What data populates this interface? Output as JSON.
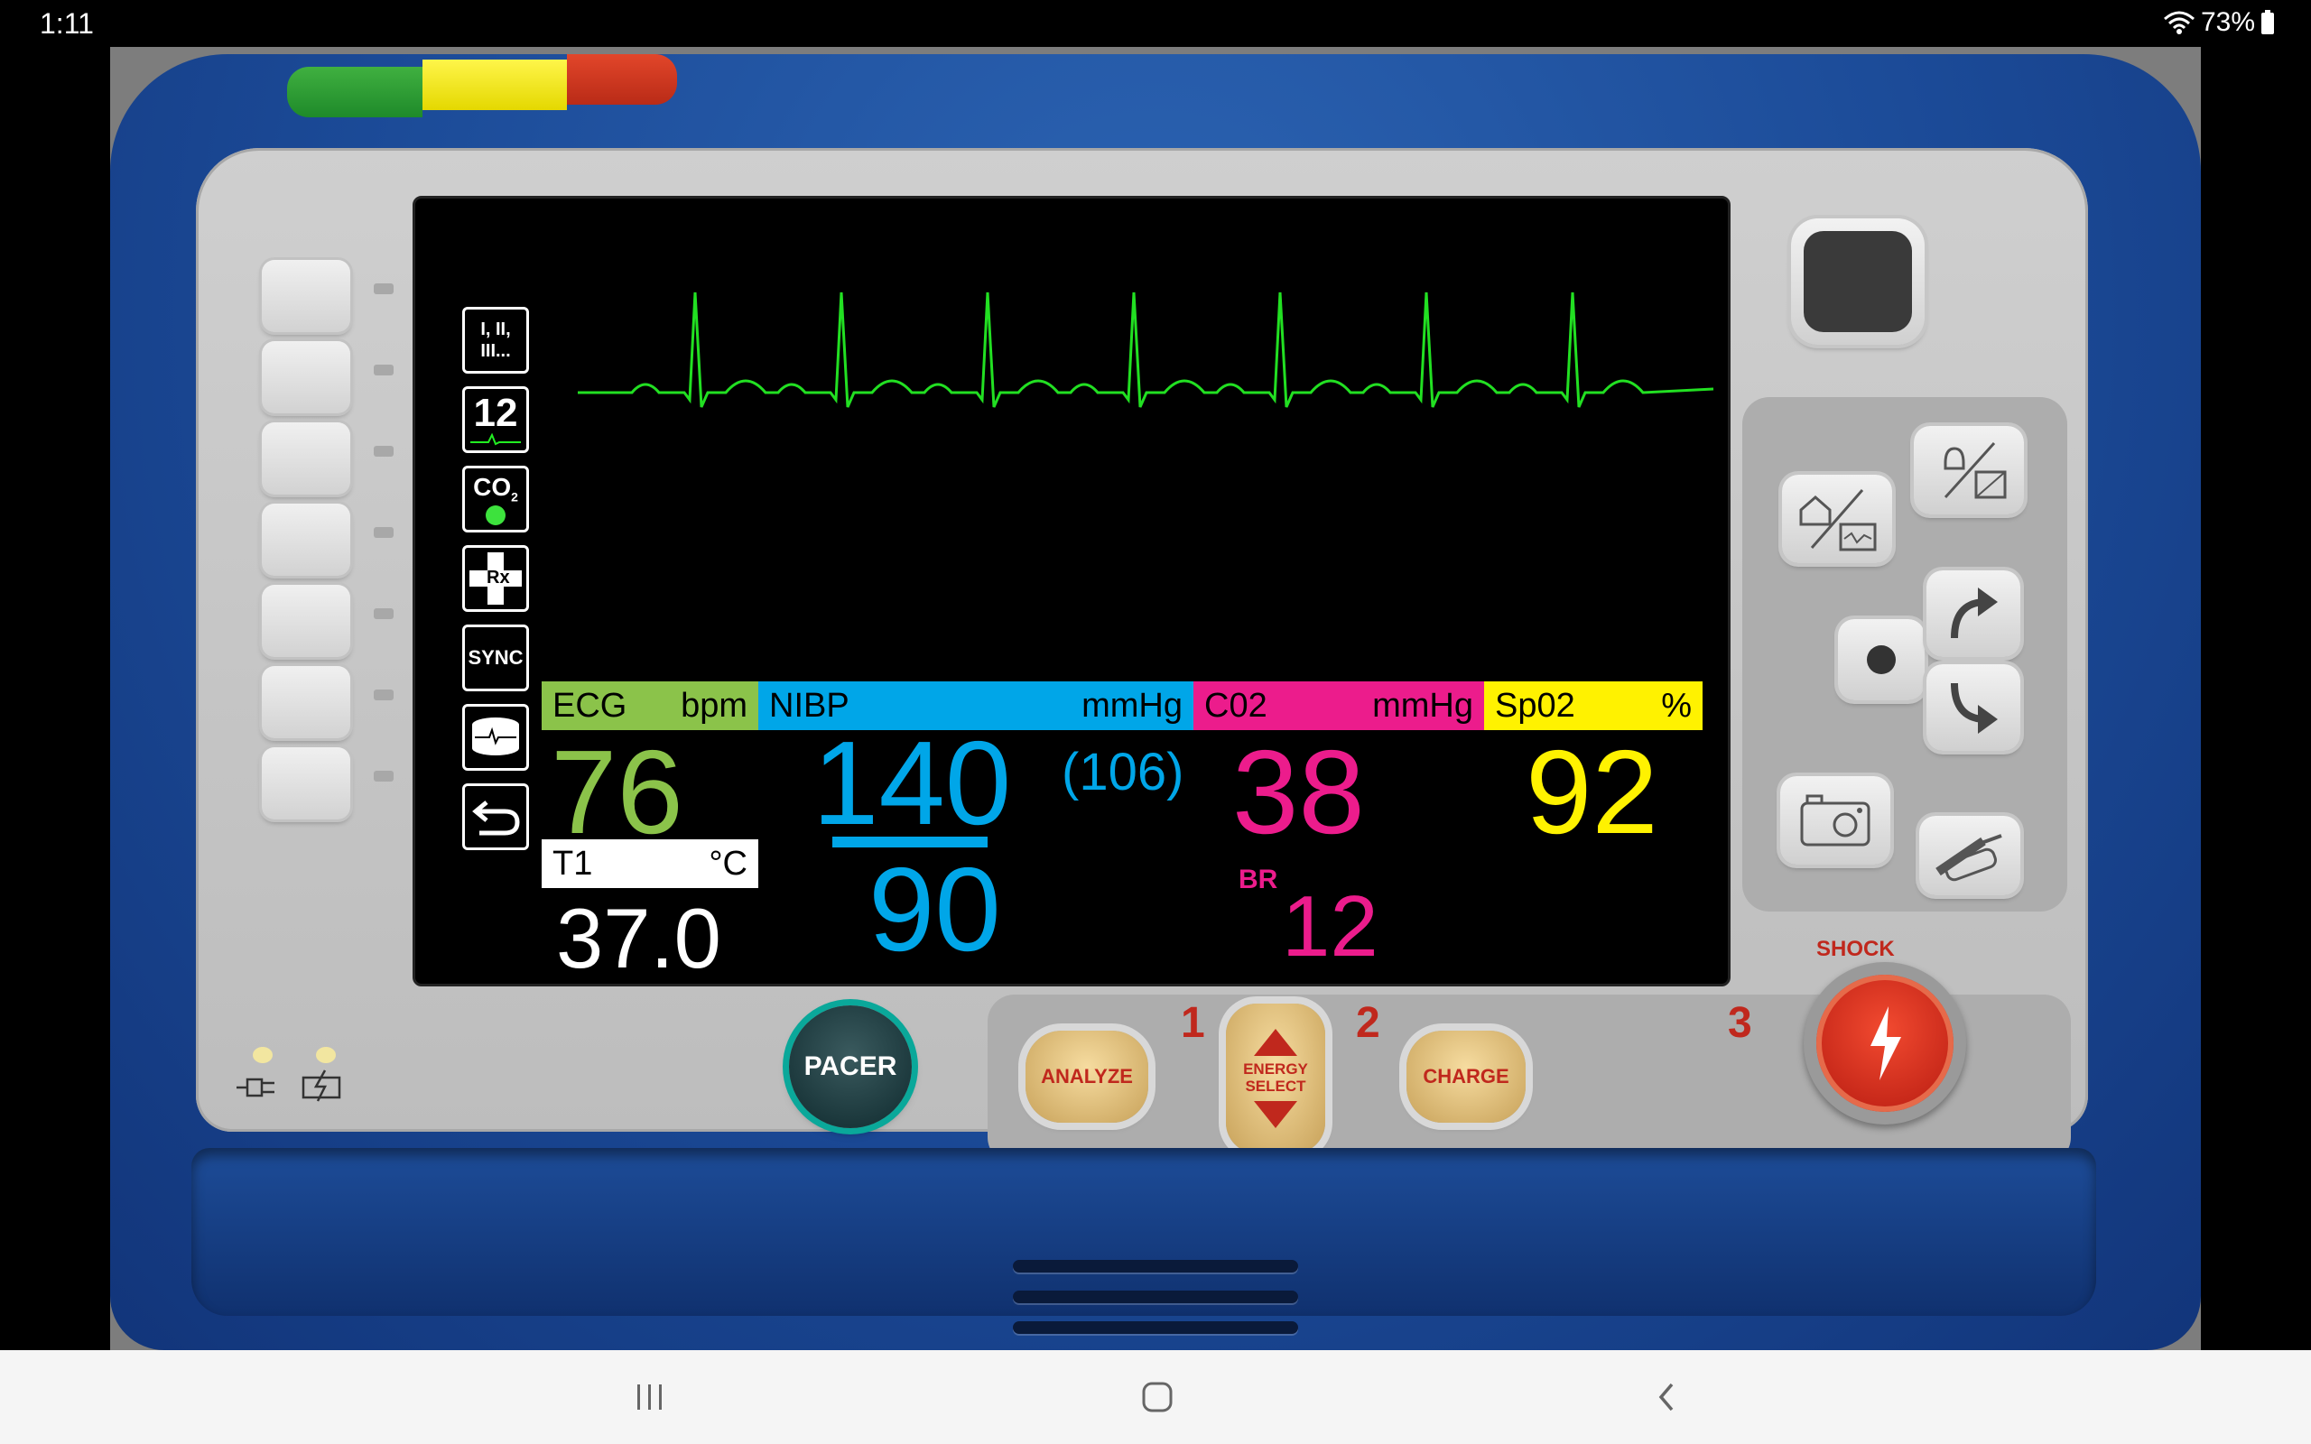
{
  "status_bar": {
    "time": "1:11",
    "battery": "73%"
  },
  "menu_icons": {
    "leads": "I, II, III...",
    "twelve": "12",
    "co2": "CO",
    "co2_sub": "2",
    "rx": "Rx",
    "sync": "SYNC"
  },
  "vitals": {
    "ecg": {
      "label": "ECG",
      "unit": "bpm",
      "value": "76",
      "color": "#8bc34a"
    },
    "nibp": {
      "label": "NIBP",
      "unit": "mmHg",
      "systolic": "140",
      "diastolic": "90",
      "mean": "(106)",
      "color": "#00a6e8"
    },
    "co2": {
      "label": "C02",
      "unit": "mmHg",
      "value": "38",
      "br_label": "BR",
      "br_value": "12",
      "color": "#ec1c8c"
    },
    "spo2": {
      "label": "Sp02",
      "unit": "%",
      "value": "92",
      "color": "#fff200"
    },
    "temp": {
      "label": "T1",
      "unit": "°C",
      "value": "37.0"
    }
  },
  "ecg_wave_color": "#22e022",
  "controls": {
    "pacer": "PACER",
    "analyze": "ANALYZE",
    "energy_line1": "ENERGY",
    "energy_line2": "SELECT",
    "charge": "CHARGE",
    "shock": "SHOCK",
    "step1": "1",
    "step2": "2",
    "step3": "3"
  },
  "colors": {
    "device_blue": "#1b4a97",
    "face_gray": "#c6c6c6",
    "gold": "#e4c27f",
    "shock_red": "#d4231a"
  }
}
